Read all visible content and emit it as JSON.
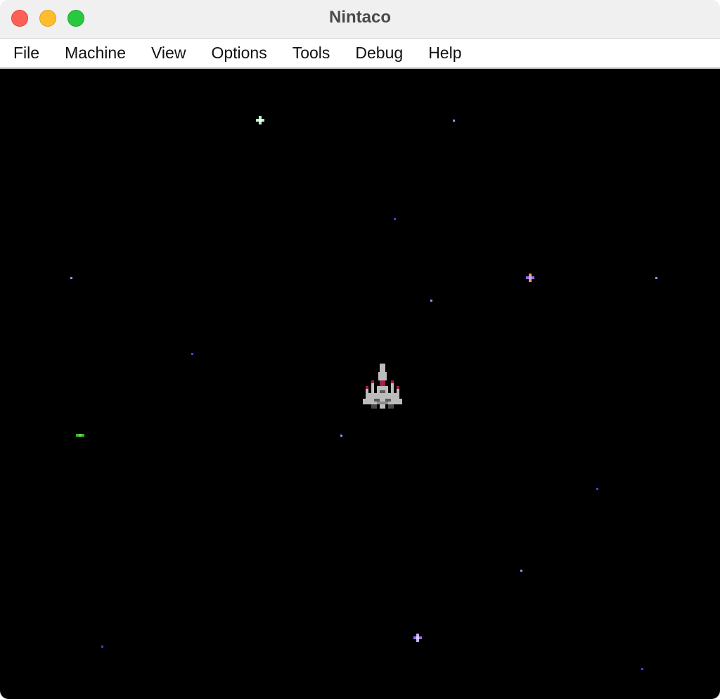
{
  "window": {
    "title": "Nintaco"
  },
  "menubar": {
    "items": [
      {
        "label": "File"
      },
      {
        "label": "Machine"
      },
      {
        "label": "View"
      },
      {
        "label": "Options"
      },
      {
        "label": "Tools"
      },
      {
        "label": "Debug"
      },
      {
        "label": "Help"
      }
    ]
  },
  "screen": {
    "background": "#000000",
    "sprite": "player-spaceship",
    "star_colors": {
      "green_white": "#b8f5c8",
      "lavender": "#a88cff",
      "blue": "#4a3cff",
      "green": "#3db22c",
      "purple": "#9d6bff"
    }
  }
}
